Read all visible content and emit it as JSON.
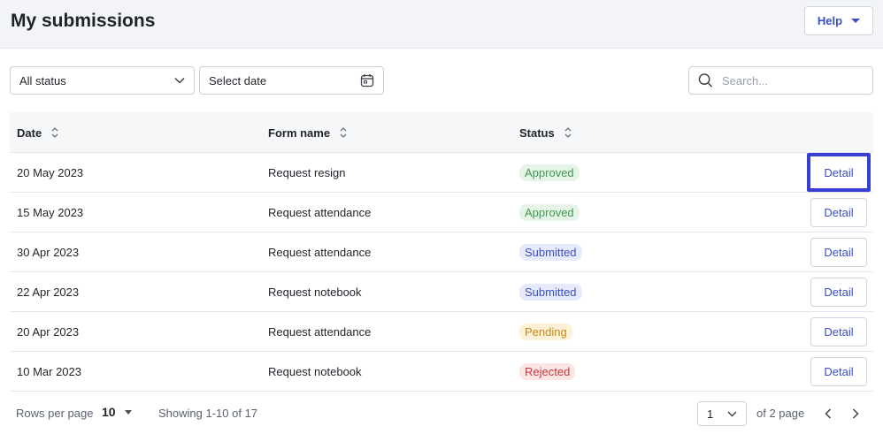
{
  "header": {
    "title": "My submissions",
    "help_label": "Help"
  },
  "filters": {
    "status_value": "All status",
    "date_value": "Select date",
    "search_placeholder": "Search..."
  },
  "table": {
    "columns": [
      "Date",
      "Form name",
      "Status"
    ],
    "action_label": "Detail",
    "rows": [
      {
        "date": "20 May 2023",
        "form": "Request resign",
        "status": "Approved"
      },
      {
        "date": "15 May 2023",
        "form": "Request attendance",
        "status": "Approved"
      },
      {
        "date": "30 Apr 2023",
        "form": "Request attendance",
        "status": "Submitted"
      },
      {
        "date": "22 Apr 2023",
        "form": "Request notebook",
        "status": "Submitted"
      },
      {
        "date": "20 Apr 2023",
        "form": "Request attendance",
        "status": "Pending"
      },
      {
        "date": "10 Mar 2023",
        "form": "Request notebook",
        "status": "Rejected"
      }
    ]
  },
  "status_colors": {
    "Approved": {
      "bg": "#e6f4e8",
      "fg": "#3f9a4e"
    },
    "Submitted": {
      "bg": "#e6eafb",
      "fg": "#3a4fc4"
    },
    "Pending": {
      "bg": "#fdf1d8",
      "fg": "#c68a14"
    },
    "Rejected": {
      "bg": "#fbe5e5",
      "fg": "#c9393b"
    }
  },
  "footer": {
    "rows_per_page_label": "Rows per page",
    "rows_per_page_value": "10",
    "showing": "Showing 1-10 of 17",
    "page_value": "1",
    "of_pages": "of 2 page"
  },
  "icons": {
    "help_caret": "chevron-down-icon",
    "status_caret": "chevron-down-icon",
    "date": "calendar-icon",
    "search": "search-icon",
    "sort": "sort-icon",
    "prev": "chevron-left-icon",
    "next": "chevron-right-icon"
  },
  "accent_color": "#3a4fc4"
}
